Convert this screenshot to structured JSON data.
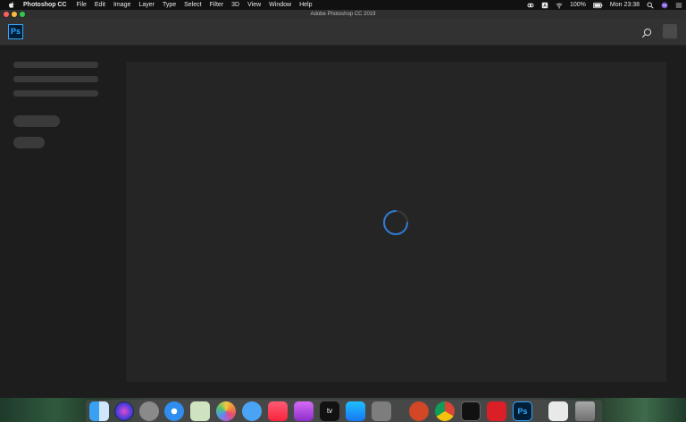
{
  "menubar": {
    "app_name": "Photoshop CC",
    "items": [
      "File",
      "Edit",
      "Image",
      "Layer",
      "Type",
      "Select",
      "Filter",
      "3D",
      "View",
      "Window",
      "Help"
    ],
    "battery": "100%",
    "clock": "Mon 23:38"
  },
  "window": {
    "title": "Adobe Photoshop CC 2019"
  },
  "header": {
    "logo_text": "Ps"
  },
  "colors": {
    "accent": "#31a8ff",
    "spinner": "#2f7dd8"
  },
  "dock": {
    "icons": [
      "finder-icon",
      "siri-icon",
      "launchpad-icon",
      "safari-icon",
      "preview-icon",
      "photos-icon",
      "messages-icon",
      "music-icon",
      "podcasts-icon",
      "tv-icon",
      "app-store-icon",
      "system-preferences-icon",
      "powerpoint-icon",
      "chrome-icon",
      "terminal-icon",
      "creative-cloud-icon",
      "photoshop-icon",
      "keyboard-viewer-icon",
      "trash-icon"
    ],
    "tv_label": "tv",
    "ps_label": "Ps"
  }
}
